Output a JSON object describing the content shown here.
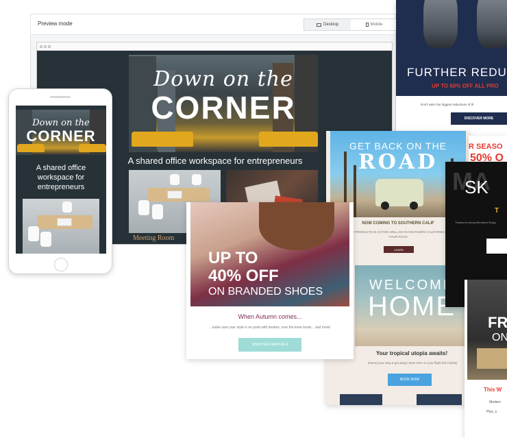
{
  "preview": {
    "title": "Preview mode",
    "toggle_desktop": "Desktop",
    "toggle_mobile": "Mobile"
  },
  "corner_email": {
    "script": "Down on the",
    "headline": "CORNER",
    "tagline": "A shared office workspace for entrepreneurs",
    "caption": "Meeting Room"
  },
  "phone_email": {
    "script": "Down on the",
    "headline": "CORNER",
    "tagline": "A shared office workspace for entrepreneurs"
  },
  "further_email": {
    "title": "FURTHER REDUC",
    "subtitle": "UP TO 60% OFF ALL PRO",
    "body": "Don't wait! Our biggest reductions of th",
    "button": "DISCOVER MORE"
  },
  "road_email": {
    "small": "GET BACK ON THE",
    "big": "ROAD",
    "subtitle": "NOW COMING TO SOUTHERN CALIF",
    "body": "NEWER PRODUCTS IN ACTION WELL GO IN SOUTHERN CALIFORNIA JUST YOUR PICKS",
    "button": "LEARN",
    "welcome_small": "WELCOME",
    "welcome_big": "HOME",
    "tropical_title": "Your tropical utopia awaits!",
    "tropical_body": "Extend your stay & get away! Save 20% on your flight this holiday",
    "tropical_button": "BOOK NOW"
  },
  "season_email": {
    "line1": "R SEASO",
    "line2": "50% O"
  },
  "black_email": {
    "bg_text": "MA",
    "headline": "SK",
    "accent": "T",
    "body": "Thanks for being Members! Enjoy"
  },
  "free_email": {
    "title1": "FRE",
    "title2": "ON",
    "subtitle": "This W",
    "body1": "Modern",
    "body2": "Plus, s"
  },
  "shoes_email": {
    "up_to": "UP TO",
    "percent": "40% OFF",
    "on": "ON BRANDED SHOES",
    "title": "When Autumn comes...",
    "body": "...make sure your style is on point with booties, over the knee boots... and more!",
    "button": "SHOP NEW ARRIVALS"
  },
  "colors": {
    "dark_bg": "#263238",
    "navy": "#1f2d4f",
    "red_accent": "#e63b2e",
    "teal_button": "#9fdcd8",
    "blue_button": "#4aa3df",
    "plum_text": "#7d2a58"
  }
}
